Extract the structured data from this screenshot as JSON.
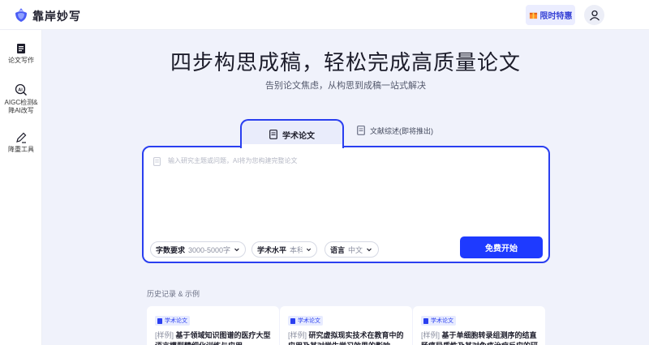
{
  "app": {
    "brand": "靠岸妙写"
  },
  "header": {
    "promo_label": "限时特惠"
  },
  "sidebar": {
    "items": [
      {
        "label": "论文写作"
      },
      {
        "label": "AIGC检测&\n降AI改写"
      },
      {
        "label": "降重工具"
      }
    ]
  },
  "hero": {
    "title": "四步构思成稿，轻松完成高质量论文",
    "subtitle": "告别论文焦虑，从构思到成稿一站式解决"
  },
  "tabs": [
    {
      "label": "学术论文",
      "active": true
    },
    {
      "label": "文献综述(即将推出)",
      "active": false
    }
  ],
  "editor": {
    "placeholder": "输入研究主题或问题，AI将为您构建完整论文",
    "options": [
      {
        "label": "字数要求",
        "value": "3000-5000字"
      },
      {
        "label": "学术水平",
        "value": "本科"
      },
      {
        "label": "语言",
        "value": "中文"
      }
    ],
    "submit_label": "免费开始"
  },
  "history": {
    "title": "历史记录 & 示例",
    "cards": [
      {
        "tag": "学术论文",
        "prefix": "[样例]",
        "text": "基于领域知识图谱的医疗大型语言模型精细化训练与应用"
      },
      {
        "tag": "学术论文",
        "prefix": "[样例]",
        "text": "研究虚拟现实技术在教育中的应用及其对学生学习效果的影响"
      },
      {
        "tag": "学术论文",
        "prefix": "[样例]",
        "text": "基于单细胞转录组测序的结直肠癌异质性及其对免疫治疗反应的研究"
      }
    ]
  },
  "colors": {
    "accent": "#1e3aff",
    "background": "#f0f2fb",
    "tag_bg": "#e7ebff"
  },
  "icons": [
    "brand-logo-icon",
    "gift-icon",
    "user-icon",
    "document-icon",
    "ai-check-icon",
    "pen-icon",
    "chevron-down-icon"
  ]
}
